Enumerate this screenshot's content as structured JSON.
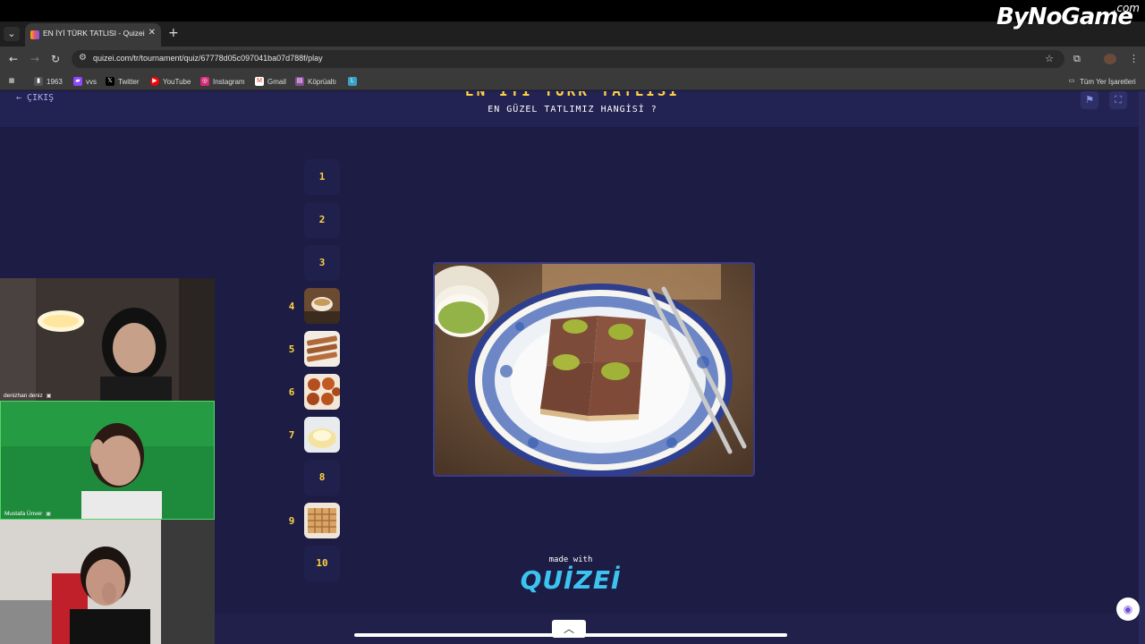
{
  "browser": {
    "tab": {
      "title": "EN İYİ TÜRK TATLISI - Quizei"
    },
    "url": "quizei.com/tr/tournament/quiz/67778d05c097041ba07d788f/play",
    "bookmarks": [
      "1963",
      "vvs",
      "Twitter",
      "YouTube",
      "Instagram",
      "Gmail",
      "Köprüaltı",
      "L"
    ],
    "all_bookmarks_label": "Tüm Yer İşaretleri"
  },
  "watermark": {
    "main": "ByNoGame",
    "suffix": ".com"
  },
  "quiz": {
    "exit_label": "ÇIKIŞ",
    "title": "EN İYİ TÜRK TATLISI",
    "subtitle": "EN GÜZEL TATLIMIZ HANGİSİ ?",
    "slots": [
      {
        "number": "1",
        "has_image": false
      },
      {
        "number": "2",
        "has_image": false
      },
      {
        "number": "3",
        "has_image": false
      },
      {
        "number": "4",
        "has_image": true
      },
      {
        "number": "5",
        "has_image": true
      },
      {
        "number": "6",
        "has_image": true
      },
      {
        "number": "7",
        "has_image": true
      },
      {
        "number": "8",
        "has_image": false
      },
      {
        "number": "9",
        "has_image": true
      },
      {
        "number": "10",
        "has_image": false
      }
    ],
    "made_with": "made with",
    "brand": "QUİZEİ"
  },
  "webcams": [
    {
      "name": "denizhan deniz"
    },
    {
      "name": "Mustafa Ünver"
    },
    {
      "name": ""
    }
  ],
  "colors": {
    "page_bg": "#1c1c45",
    "accent_yellow": "#ffd23f",
    "brand_blue": "#3cc3f0"
  }
}
